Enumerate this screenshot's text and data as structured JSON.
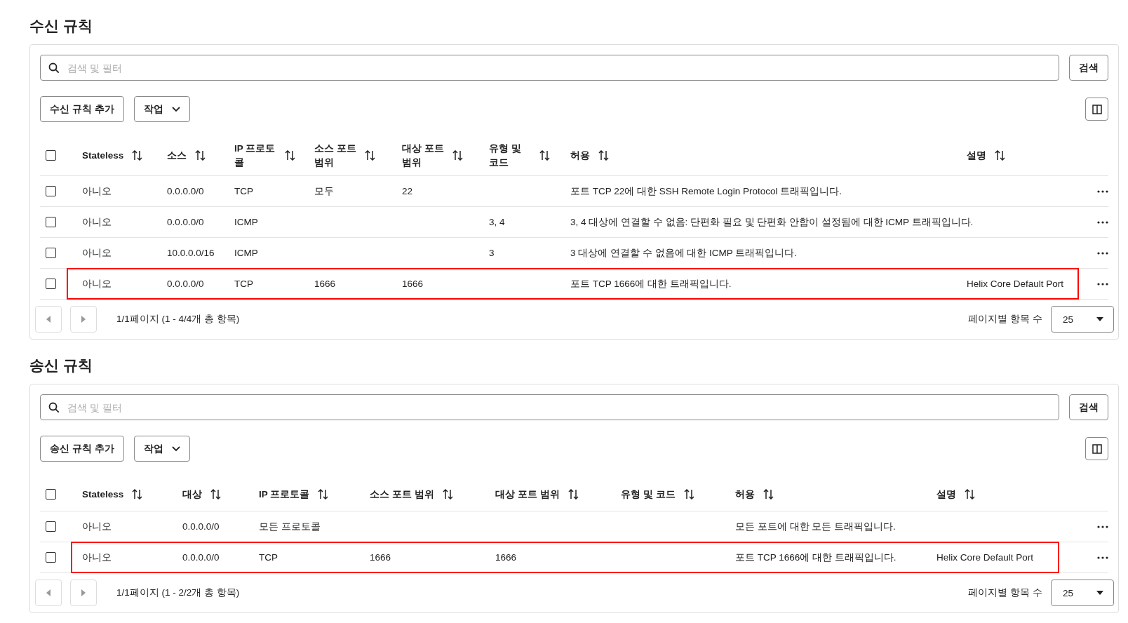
{
  "sections": [
    {
      "title": "수신 규칙",
      "search": {
        "placeholder": "검색 및 필터"
      },
      "search_button": "검색",
      "add_button": "수신 규칙 추가",
      "actions_button": "작업",
      "select_all_checked": false,
      "columns": [
        "Stateless",
        "소스",
        "IP 프로토콜",
        "소스 포트 범위",
        "대상 포트 범위",
        "유형 및 코드",
        "허용",
        "설명"
      ],
      "rows": [
        {
          "checked": false,
          "highlighted": false,
          "cells": [
            "아니오",
            "0.0.0.0/0",
            "TCP",
            "모두",
            "22",
            null,
            "포트 TCP 22에 대한 SSH Remote Login Protocol 트래픽입니다.",
            null
          ]
        },
        {
          "checked": false,
          "highlighted": false,
          "cells": [
            "아니오",
            "0.0.0.0/0",
            "ICMP",
            null,
            null,
            "3, 4",
            "3, 4 대상에 연결할 수 없음: 단편화 필요 및 단편화 안함이 설정됨에 대한 ICMP 트래픽입니다.",
            null
          ]
        },
        {
          "checked": false,
          "highlighted": false,
          "cells": [
            "아니오",
            "10.0.0.0/16",
            "ICMP",
            null,
            null,
            "3",
            "3 대상에 연결할 수 없음에 대한 ICMP 트래픽입니다.",
            null
          ]
        },
        {
          "checked": false,
          "highlighted": true,
          "cells": [
            "아니오",
            "0.0.0.0/0",
            "TCP",
            "1666",
            "1666",
            null,
            "포트 TCP 1666에 대한 트래픽입니다.",
            "Helix Core Default Port"
          ]
        }
      ],
      "pagination": {
        "summary": "1/1페이지 (1 - 4/4개 총 항목)",
        "page_size_label": "페이지별 항목 수",
        "page_size": "25"
      }
    },
    {
      "title": "송신 규칙",
      "search": {
        "placeholder": "검색 및 필터"
      },
      "search_button": "검색",
      "add_button": "송신 규칙 추가",
      "actions_button": "작업",
      "select_all_checked": false,
      "columns": [
        "Stateless",
        "대상",
        "IP 프로토콜",
        "소스 포트 범위",
        "대상 포트 범위",
        "유형 및 코드",
        "허용",
        "설명"
      ],
      "rows": [
        {
          "checked": false,
          "highlighted": false,
          "cells": [
            "아니오",
            "0.0.0.0/0",
            "모든 프로토콜",
            null,
            null,
            null,
            "모든 포트에 대한 모든 트래픽입니다.",
            null
          ]
        },
        {
          "checked": false,
          "highlighted": true,
          "cells": [
            "아니오",
            "0.0.0.0/0",
            "TCP",
            "1666",
            "1666",
            null,
            "포트 TCP 1666에 대한 트래픽입니다.",
            "Helix Core Default Port"
          ]
        }
      ],
      "pagination": {
        "summary": "1/1페이지 (1 - 2/2개 총 항목)",
        "page_size_label": "페이지별 항목 수",
        "page_size": "25"
      }
    }
  ]
}
